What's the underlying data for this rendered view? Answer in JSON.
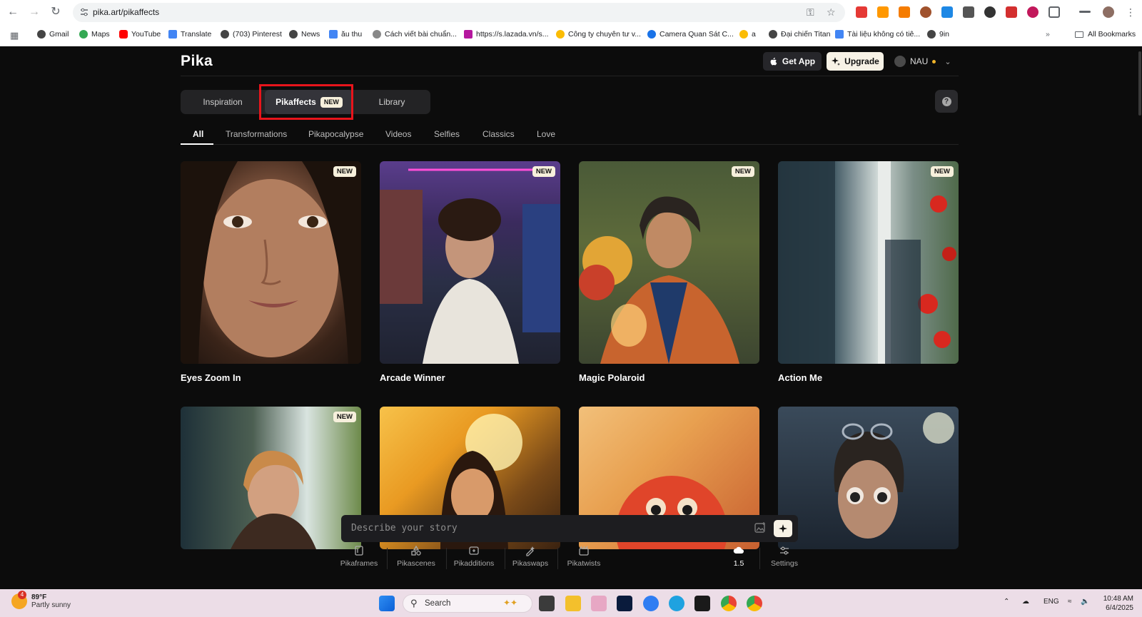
{
  "browser": {
    "url": "pika.art/pikaffects",
    "bookmarks": [
      {
        "label": "Gmail",
        "color": "#444444"
      },
      {
        "label": "Maps",
        "color": "#34a853"
      },
      {
        "label": "YouTube",
        "color": "#ff0000"
      },
      {
        "label": "Translate",
        "color": "#4285f4"
      },
      {
        "label": "(703) Pinterest",
        "color": "#444444"
      },
      {
        "label": "News",
        "color": "#444444"
      },
      {
        "label": "ău thu",
        "color": "#4285f4"
      },
      {
        "label": "Cách viết bài chuẩn...",
        "color": "#888888"
      },
      {
        "label": "https://s.lazada.vn/s...",
        "color": "#b5179e"
      },
      {
        "label": "Công ty chuyên tư v...",
        "color": "#fbbc04"
      },
      {
        "label": "Camera Quan Sát C...",
        "color": "#1a73e8"
      },
      {
        "label": "a",
        "color": "#fbbc04"
      },
      {
        "label": "Đại chiến Titan",
        "color": "#444444"
      },
      {
        "label": "Tài liệu không có tiê...",
        "color": "#4285f4"
      },
      {
        "label": "9in",
        "color": "#444444"
      }
    ],
    "all_bookmarks_label": "All Bookmarks"
  },
  "header": {
    "logo": "Pika",
    "get_app": "Get App",
    "upgrade": "Upgrade",
    "user_name": "NAU"
  },
  "main_tabs": [
    {
      "label": "Inspiration",
      "active": false
    },
    {
      "label": "Pikaffects",
      "active": true,
      "badge": "NEW"
    },
    {
      "label": "Library",
      "active": false
    }
  ],
  "help_label": "?",
  "filter_tabs": [
    "All",
    "Transformations",
    "Pikapocalypse",
    "Videos",
    "Selfies",
    "Classics",
    "Love"
  ],
  "new_badge": "NEW",
  "cards": [
    {
      "title": "Eyes Zoom In",
      "new": true
    },
    {
      "title": "Arcade Winner",
      "new": true
    },
    {
      "title": "Magic Polaroid",
      "new": true
    },
    {
      "title": "Action Me",
      "new": true
    },
    {
      "title": "",
      "new": true
    },
    {
      "title": "",
      "new": false
    },
    {
      "title": "",
      "new": false
    },
    {
      "title": "",
      "new": false
    }
  ],
  "prompt": {
    "placeholder": "Describe your story"
  },
  "tools": [
    "Pikaframes",
    "Pikascenes",
    "Pikadditions",
    "Pikaswaps",
    "Pikatwists"
  ],
  "model_version": "1.5",
  "settings_label": "Settings",
  "taskbar": {
    "weather_temp": "89°F",
    "weather_desc": "Partly sunny",
    "weather_badge": "4",
    "search_label": "Search",
    "lang": "ENG",
    "time": "10:48 AM",
    "date": "6/4/2025"
  }
}
